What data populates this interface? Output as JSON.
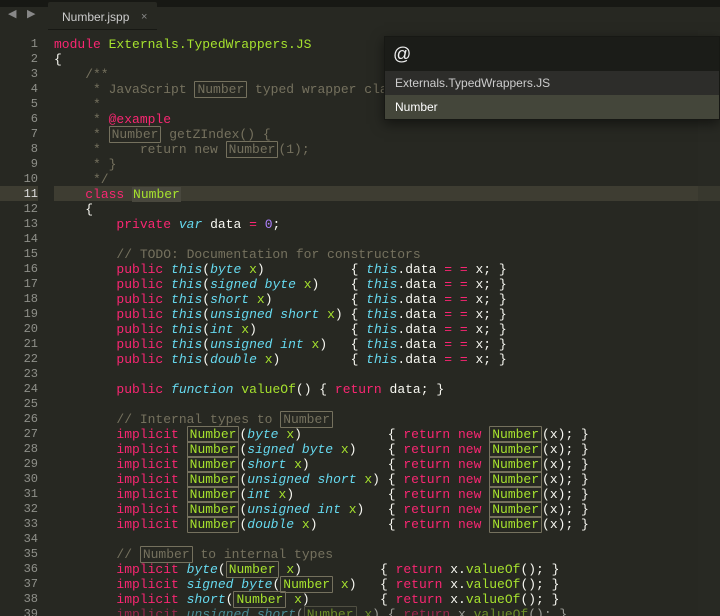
{
  "nav_arrows": "◀ ▶",
  "tab": {
    "title": "Number.jspp",
    "close": "×"
  },
  "panel": {
    "value": "@",
    "rows": [
      "Externals.TypedWrappers.JS",
      "Number"
    ],
    "selected_index": 1
  },
  "gutter_start": 1,
  "gutter_end": 39,
  "highlight_line": 11,
  "code": {
    "l1": {
      "a": "module",
      "b": " ",
      "c": "Externals.TypedWrappers.JS"
    },
    "l2": "{",
    "l3": "    /**",
    "l4a": "     * JavaScript ",
    "l4b": "Number",
    "l4c": " typed wrapper class for",
    "l5": "     *",
    "l6a": "     * ",
    "l6b": "@example",
    "l7a": "     * ",
    "l7b": "Number",
    "l7c": " getZIndex() {",
    "l8a": "     *     return new ",
    "l8b": "Number",
    "l8c": "(1);",
    "l9": "     * }",
    "l10": "     */",
    "l11a": "    ",
    "l11b": "class",
    "l11c": " ",
    "l11d": "Number",
    "l12": "    {",
    "l13a": "        ",
    "l13b": "private",
    "l13c": " ",
    "l13d": "var",
    "l13e": " ",
    "l13f": "data",
    "l13g": " ",
    "l13h": "=",
    "l13i": " ",
    "l13j": "0",
    "l13k": ";",
    "l14": "",
    "l15": "        // TODO: Documentation for constructors",
    "ctor": [
      {
        "t": "byte",
        "pad": "          "
      },
      {
        "t": "signed byte",
        "pad": "   "
      },
      {
        "t": "short",
        "pad": "         "
      },
      {
        "t": "unsigned short",
        "pad": ""
      },
      {
        "t": "int",
        "pad": "           "
      },
      {
        "t": "unsigned int",
        "pad": "  "
      },
      {
        "t": "double",
        "pad": "        "
      }
    ],
    "ctor_pre": "        ",
    "ctor_pub": "public",
    "ctor_this": "this",
    "ctor_x": "x",
    "ctor_brace_l": ") ",
    "ctor_body_l": "{ ",
    "ctor_thisdot": "this",
    "ctor_dot": ".",
    "ctor_data": "data",
    "ctor_eq": " = ",
    "ctor_xr": "x",
    "ctor_end": "; }",
    "l23": "",
    "l24a": "        ",
    "l24b": "public",
    "l24c": " ",
    "l24d": "function",
    "l24e": " ",
    "l24f": "valueOf",
    "l24g": "() { ",
    "l24h": "return",
    "l24i": " data; }",
    "l25": "",
    "l26a": "        // Internal types to ",
    "l26b": "Number",
    "impl_to": [
      {
        "t": "byte",
        "pad": "          "
      },
      {
        "t": "signed byte",
        "pad": "   "
      },
      {
        "t": "short",
        "pad": "         "
      },
      {
        "t": "unsigned short",
        "pad": ""
      },
      {
        "t": "int",
        "pad": "           "
      },
      {
        "t": "unsigned int",
        "pad": "  "
      },
      {
        "t": "double",
        "pad": "        "
      }
    ],
    "impl_pre": "        ",
    "impl_kw": "implicit",
    "impl_num": "Number",
    "impl_x": "x",
    "impl_body_l": "{ ",
    "impl_ret": "return",
    "impl_new": "new",
    "impl_xr": "x",
    "impl_end": "); }",
    "l34": "",
    "l35a": "        // ",
    "l35b": "Number",
    "l35c": " to internal types",
    "impl_from": [
      {
        "t": "byte",
        "pad": "         "
      },
      {
        "t": "signed byte",
        "pad": "  "
      },
      {
        "t": "short",
        "pad": "        "
      },
      {
        "t": "unsigned short",
        "pad": ""
      }
    ],
    "from_body": "{ ",
    "from_ret": "return",
    "from_x": "x",
    "from_dot": ".",
    "from_vo": "valueOf",
    "from_end": "(); }"
  }
}
